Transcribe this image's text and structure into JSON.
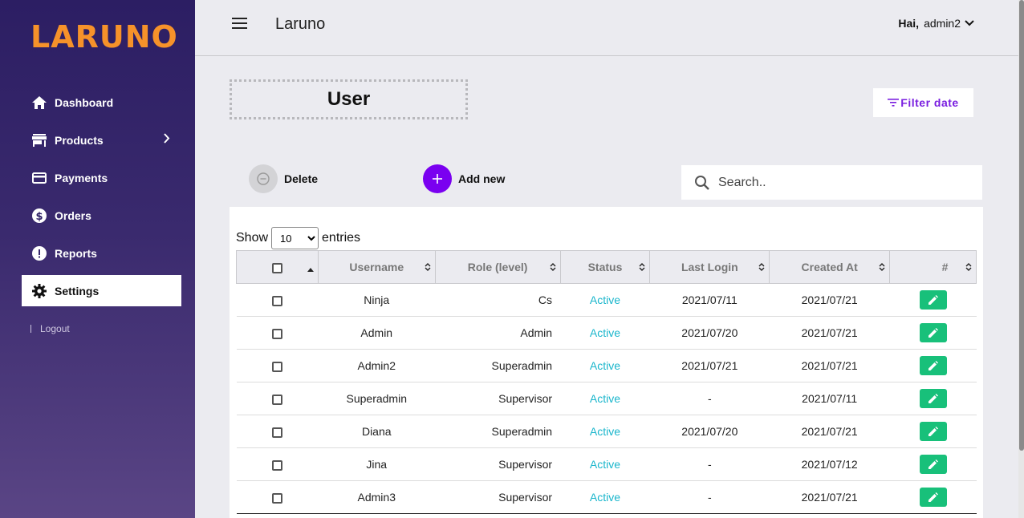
{
  "brand": {
    "logo": "LARUNO"
  },
  "sidebar": {
    "items": [
      {
        "label": "Dashboard"
      },
      {
        "label": "Products"
      },
      {
        "label": "Payments"
      },
      {
        "label": "Orders"
      },
      {
        "label": "Reports"
      },
      {
        "label": "Settings"
      }
    ],
    "logout": "Logout"
  },
  "header": {
    "title": "Laruno",
    "greeting": "Hai,",
    "username": "admin2"
  },
  "page": {
    "title": "User",
    "filter_label": "Filter date"
  },
  "actions": {
    "delete_label": "Delete",
    "add_label": "Add new"
  },
  "search": {
    "placeholder": "Search.."
  },
  "table": {
    "show_label": "Show",
    "entries_label": "entries",
    "page_size": "10",
    "columns": [
      "Username",
      "Role (level)",
      "Status",
      "Last Login",
      "Created At",
      "#"
    ],
    "rows": [
      {
        "username": "Ninja",
        "role": "Cs",
        "status": "Active",
        "last_login": "2021/07/11",
        "created_at": "2021/07/21"
      },
      {
        "username": "Admin",
        "role": "Admin",
        "status": "Active",
        "last_login": "2021/07/20",
        "created_at": "2021/07/21"
      },
      {
        "username": "Admin2",
        "role": "Superadmin",
        "status": "Active",
        "last_login": "2021/07/21",
        "created_at": "2021/07/21"
      },
      {
        "username": "Superadmin",
        "role": "Supervisor",
        "status": "Active",
        "last_login": "-",
        "created_at": "2021/07/11"
      },
      {
        "username": "Diana",
        "role": "Superadmin",
        "status": "Active",
        "last_login": "2021/07/20",
        "created_at": "2021/07/21"
      },
      {
        "username": "Jina",
        "role": "Supervisor",
        "status": "Active",
        "last_login": "-",
        "created_at": "2021/07/12"
      },
      {
        "username": "Admin3",
        "role": "Supervisor",
        "status": "Active",
        "last_login": "-",
        "created_at": "2021/07/21"
      }
    ]
  },
  "colors": {
    "accent": "#7a00f0",
    "brand": "#f6922a",
    "status_active": "#1ab6cc",
    "edit": "#18c07a"
  }
}
